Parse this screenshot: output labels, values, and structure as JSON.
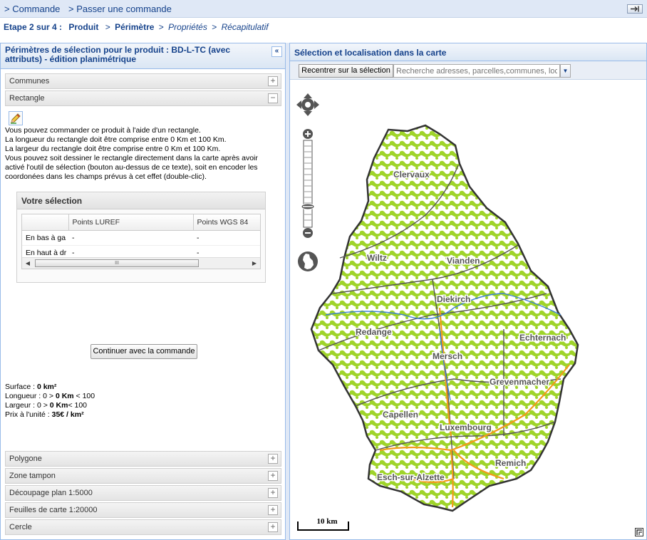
{
  "topbar": {
    "crumb1": "> Commande",
    "crumb2": "> Passer une commande"
  },
  "steps": {
    "prefix": "Etape 2 sur 4 :",
    "items": [
      "Produit",
      "Périmètre",
      "Propriétés",
      "Récapitulatif"
    ],
    "sep": ">"
  },
  "left": {
    "title": "Périmètres de sélection pour le produit : BD-L-TC (avec attributs) - édition planimétrique",
    "accordion_top": [
      {
        "label": "Communes",
        "toggle": "+"
      },
      {
        "label": "Rectangle",
        "toggle": "−"
      }
    ],
    "description": [
      "Vous pouvez commander ce produit à l'aide d'un rectangle.",
      "La longueur du rectangle doit être comprise entre 0 Km et 100 Km.",
      "La largeur du rectangle doit être comprise entre 0 Km et 100 Km.",
      "Vous pouvez soit dessiner le rectangle directement dans la carte après avoir",
      "activé l'outil de sélection (bouton au-dessus de ce texte), soit en encoder les",
      "coordonées dans les champs prévus à cet effet (double-clic)."
    ],
    "selection": {
      "title": "Votre sélection",
      "columns": [
        "",
        "Points LUREF",
        "Points WGS 84"
      ],
      "rows": [
        [
          "En bas à ga",
          "-",
          "-"
        ],
        [
          "En haut à dr",
          "-",
          "-"
        ]
      ],
      "scroll_thumb": "III"
    },
    "continue_label": "Continuer avec la commande",
    "stats": {
      "surface_label": "Surface : ",
      "surface_value": "0 km²",
      "longueur_label": "Longueur : 0 > ",
      "longueur_value": "0 Km",
      "longueur_suffix": " < 100",
      "largeur_label": "Largeur : 0 > ",
      "largeur_value": "0 Km",
      "largeur_suffix": "< 100",
      "prix_label": "Prix à l'unité : ",
      "prix_value": "35€ / km²"
    },
    "accordion_bottom": [
      {
        "label": "Polygone",
        "toggle": "+"
      },
      {
        "label": "Zone tampon",
        "toggle": "+"
      },
      {
        "label": "Découpage plan 1:5000",
        "toggle": "+"
      },
      {
        "label": "Feuilles de carte 1:20000",
        "toggle": "+"
      },
      {
        "label": "Cercle",
        "toggle": "+"
      }
    ],
    "collapse_icon": "«"
  },
  "map": {
    "title": "Sélection et localisation dans la carte",
    "recenter_label": "Recentrer sur la sélection",
    "search_placeholder": "Recherche adresses, parcelles,communes, loc",
    "scale_label": "10 km",
    "cities": [
      "Clervaux",
      "Wiltz",
      "Vianden",
      "Diekirch",
      "Redange",
      "Echternach",
      "Mersch",
      "Grevenmacher",
      "Capellen",
      "Luxembourg",
      "Remich",
      "Esch-sur-Alzette"
    ]
  }
}
